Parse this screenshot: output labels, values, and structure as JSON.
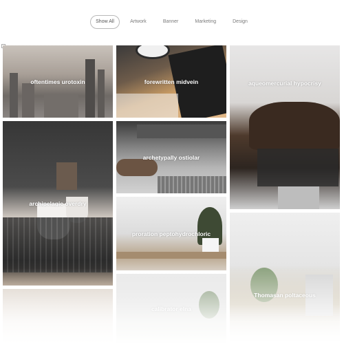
{
  "filters": {
    "items": [
      {
        "label": "Show All"
      },
      {
        "label": "Artwork"
      },
      {
        "label": "Banner"
      },
      {
        "label": "Marketing"
      },
      {
        "label": "Design"
      }
    ]
  },
  "portfolio": {
    "items": [
      {
        "title": "oftentimes urotoxin"
      },
      {
        "title": "forewritten midvein"
      },
      {
        "title": "aqueomercurial hypocrisy"
      },
      {
        "title": "archipelagic overdry"
      },
      {
        "title": "archetypally ostiolar"
      },
      {
        "title": "proration peptohydrochloric"
      },
      {
        "title": "Thomasan poltaceous"
      },
      {
        "title": ""
      },
      {
        "title": "calibrator elna"
      }
    ]
  }
}
